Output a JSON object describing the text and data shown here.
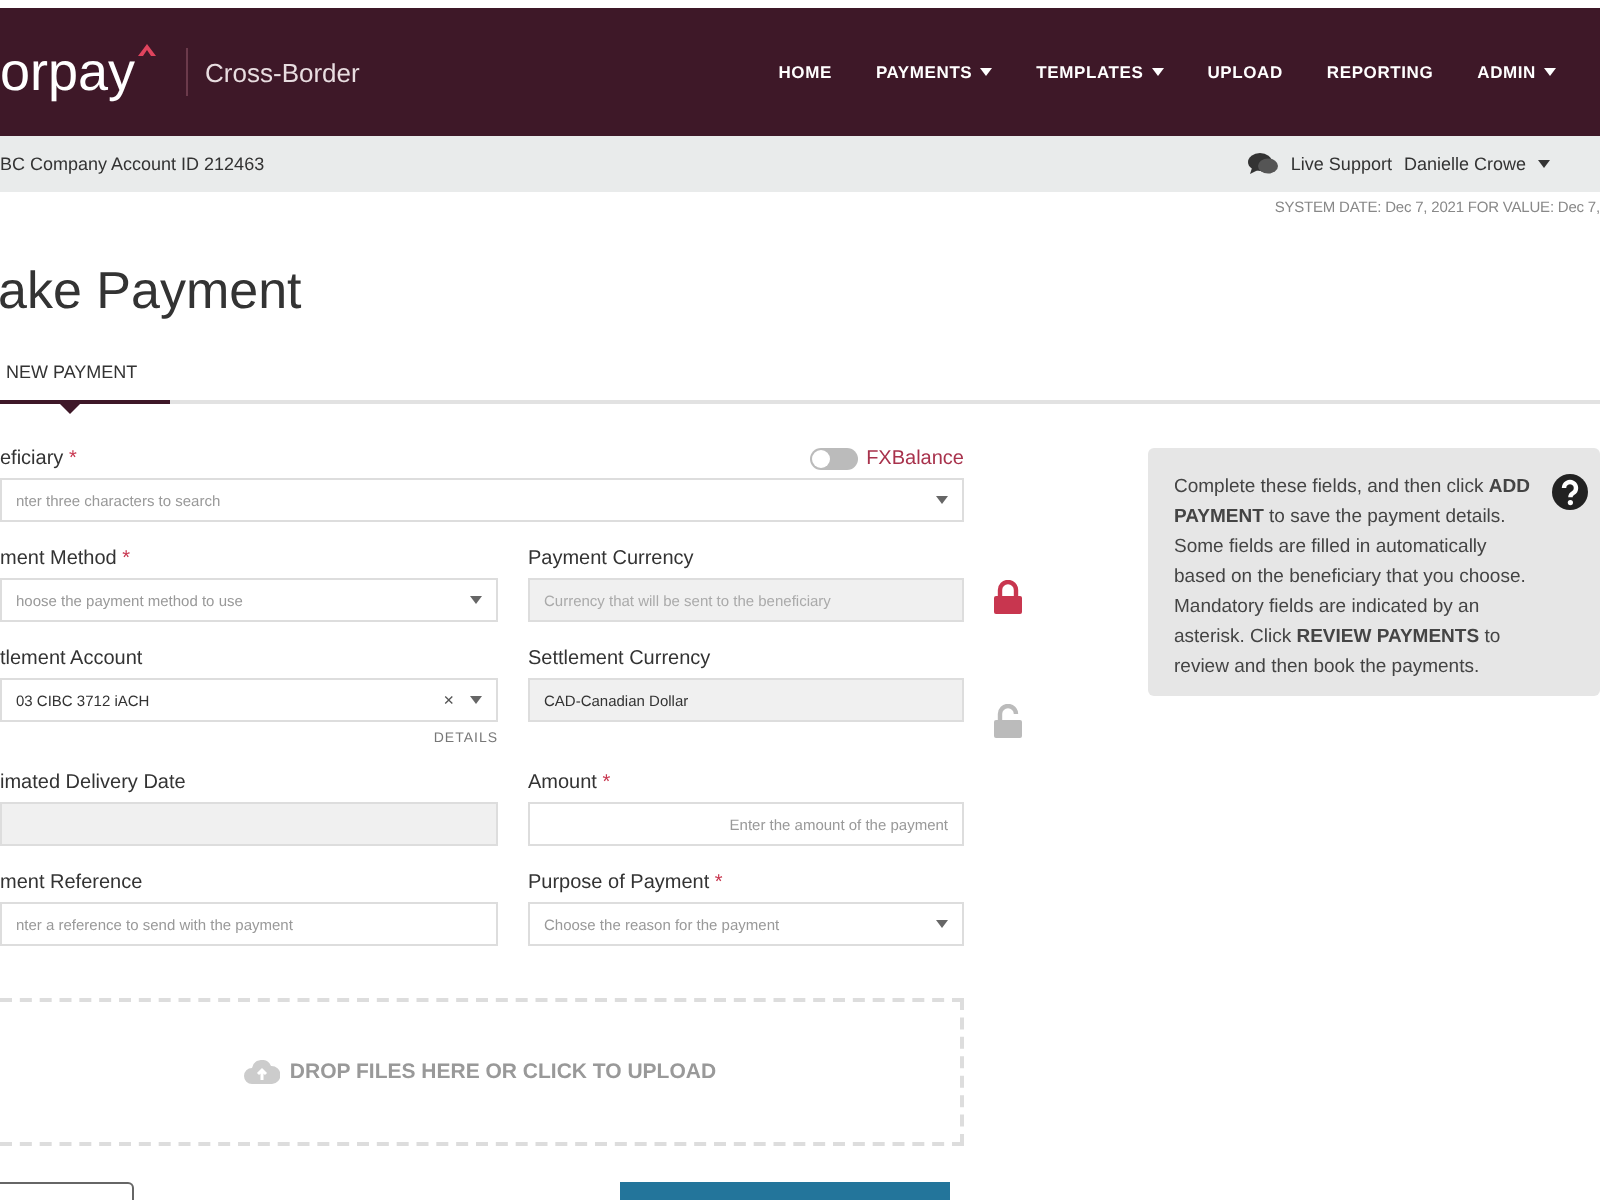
{
  "header": {
    "logo": "orpay",
    "product": "Cross-Border",
    "nav": [
      {
        "label": "HOME",
        "dropdown": false
      },
      {
        "label": "PAYMENTS",
        "dropdown": true
      },
      {
        "label": "TEMPLATES",
        "dropdown": true
      },
      {
        "label": "UPLOAD",
        "dropdown": false
      },
      {
        "label": "REPORTING",
        "dropdown": false
      },
      {
        "label": "ADMIN",
        "dropdown": true
      }
    ]
  },
  "sub_bar": {
    "account": "BC Company Account ID 212463",
    "support": "Live Support",
    "user": "Danielle Crowe"
  },
  "system_date": "SYSTEM DATE: Dec 7, 2021 FOR VALUE: Dec 7,",
  "page_title": "ake Payment",
  "tabs": [
    {
      "label": "NEW PAYMENT",
      "selected": true
    }
  ],
  "fx_toggle": {
    "label": "FXBalance",
    "on": false
  },
  "fields": [
    {
      "label": "eficiary",
      "required_mark": "*",
      "kind": "select",
      "placeholder": "nter three characters to search",
      "wide": true
    },
    {
      "label": "ment Method",
      "required_mark": "*",
      "kind": "select",
      "placeholder": "hoose the payment method to use"
    },
    {
      "label": "Payment Currency",
      "kind": "readonly",
      "placeholder": "Currency that will be sent to the beneficiary",
      "locked": true
    },
    {
      "label": "tlement Account",
      "kind": "select",
      "value": "03 CIBC 3712 iACH",
      "clear_icon": "×",
      "link": "DETAILS"
    },
    {
      "label": "Settlement Currency",
      "kind": "readonly",
      "value": "CAD-Canadian Dollar",
      "locked": false
    },
    {
      "label": "imated Delivery Date",
      "kind": "readonly"
    },
    {
      "label": "Amount",
      "required_mark": "*",
      "kind": "amount",
      "placeholder": "Enter the amount of the payment"
    },
    {
      "label": "ment Reference",
      "kind": "text",
      "placeholder": "nter a reference to send with the payment"
    },
    {
      "label": "Purpose of Payment",
      "required_mark": "*",
      "kind": "select",
      "placeholder": "Choose the reason for the payment"
    }
  ],
  "upload": {
    "label": "DROP FILES HERE OR CLICK TO UPLOAD"
  },
  "help": {
    "text": "Complete these fields, and then click **ADD PAYMENT** to save the payment details. Some fields are filled in automatically based on the beneficiary that you choose. Mandatory fields are indicated by an asterisk. Click **REVIEW PAYMENTS** to review and then book the payments."
  },
  "buttons": [
    {
      "kind": "secondary"
    },
    {
      "kind": "primary"
    }
  ]
}
